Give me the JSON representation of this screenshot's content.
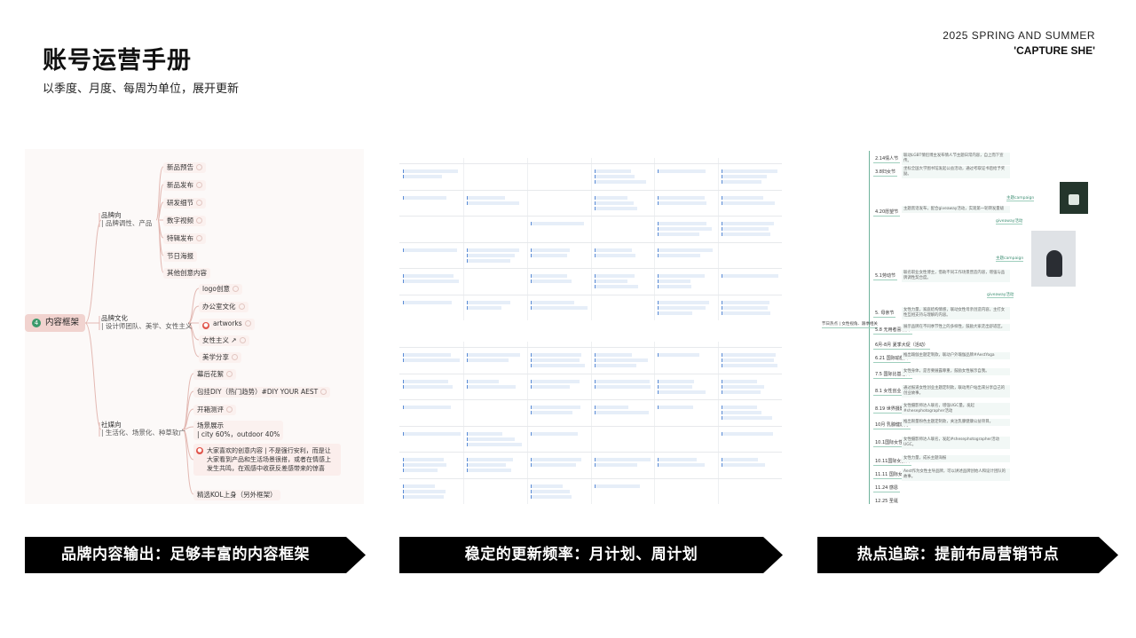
{
  "header": {
    "title": "账号运营手册",
    "subtitle": "以季度、月度、每周为单位，展开更新",
    "season_line1": "2025 SPRING AND SUMMER",
    "season_line2": "'CAPTURE SHE'"
  },
  "mindmap": {
    "root": "内容框架",
    "root_badge": "4",
    "branches": [
      {
        "title": "品牌向",
        "subtitle": "| 品牌调性、产品",
        "leaves": [
          "新品预告",
          "新品发布",
          "研发细节",
          "数字视频",
          "特辑发布",
          "节日海报",
          "其他创意内容"
        ]
      },
      {
        "title": "品牌文化",
        "subtitle": "| 设计师团队、美学、女性主义",
        "leaves": [
          "logo创意",
          "办公室文化",
          "artworks",
          "女性主义",
          "美学分享"
        ]
      },
      {
        "title": "社媒向",
        "subtitle": "| 生活化、场景化、种草软广",
        "leaves": [
          "幕后花絮",
          "包挂DIY（热门趋势）#DIY YOUR AEST",
          "开箱测评",
          "场景展示",
          "| city 60%，outdoor 40%",
          "精选KOL上身（另外框架）"
        ],
        "note": "大家喜欢的创意内容 | 不是强行安利，而是让大家看到产品和生活场景很搭，或者在情感上发生共鸣，在观感中收获反差感带来的惊喜"
      }
    ]
  },
  "timeline": {
    "root": "节日热点 | 女性视角、跟季相关",
    "items": [
      {
        "date": "2.14情人节",
        "desc": "联动LGBT情侣博主发布情人节主题日常内容，自上而下宣传。"
      },
      {
        "date": "3.8妇女节",
        "desc": "坐标全国大学图书馆发起公益活动，通过考取证书后给予奖励。"
      },
      {
        "date": "4.20愿望节",
        "desc": "主题黑话发布，配合giveaway活动，实现第一轮转发量级"
      },
      {
        "date": "5.1劳动节",
        "desc": "联名职业女性博主，借助不同工作场景营造内容，增强与品牌调性契合度。"
      },
      {
        "date": "5. 母亲节",
        "desc": "女性力量，家庭结构情感，联动女性母亲创造内容，主打女性互相支持与理解的内容。"
      },
      {
        "date": "5.8 无用者喜欢日",
        "desc": "展示品牌在不同季节性上的多样性，鼓励大家走出舒适区。"
      },
      {
        "date": "6月-8月 夏季大促（活动）",
        "desc": ""
      },
      {
        "date": "6.21 国际瑜伽日",
        "desc": "推出瑜伽主题定制款，联动户外瑜伽品牌#AestYoga"
      },
      {
        "date": "7.5 国际比基尼日",
        "desc": "女性身体，是否要展露尊重，鼓励女性展示自我。"
      },
      {
        "date": "8.1 女性创业日",
        "desc": "通过报道女性创业主题定制款，联动用户站出来分享自己的创业故事。"
      },
      {
        "date": "8.19 世界摄影日",
        "desc": "女性摄影师达人联名，增强UGC量。发起#shesephotographer活动"
      },
      {
        "date": "10月 乳腺健康月",
        "desc": "推出限量粉色主题定制款，关注乳腺健康公益项目。"
      },
      {
        "date": "10.1国际女性摄影日",
        "desc": "女性摄影师达人联名，发起#shesephotographer活动UGC。"
      },
      {
        "date": "10.11国际女孩日",
        "desc": "女性力量，成长主题海报"
      },
      {
        "date": "11.11 国际女企业家日",
        "desc": "Aest作为女性主导品牌，可以讲述品牌创始人和设计团队的故事。"
      },
      {
        "date": "11.24 感恩",
        "desc": ""
      },
      {
        "date": "12.25 圣诞",
        "desc": ""
      }
    ],
    "tags": [
      "主题campaign",
      "giveaway活动",
      "主题campaign",
      "giveaway活动"
    ]
  },
  "banners": [
    {
      "label": "品牌内容输出：足够丰富的内容框架"
    },
    {
      "label": "稳定的更新频率：月计划、周计划"
    },
    {
      "label": "热点追踪：提前布局营销节点"
    }
  ],
  "colors": {
    "banner_bg": "#000000",
    "mindmap_bg": "#fcf9f8",
    "mindmap_root": "#f1d3cf",
    "timeline_accent": "#6fb39b",
    "calendar_event": "#e6eef8"
  }
}
